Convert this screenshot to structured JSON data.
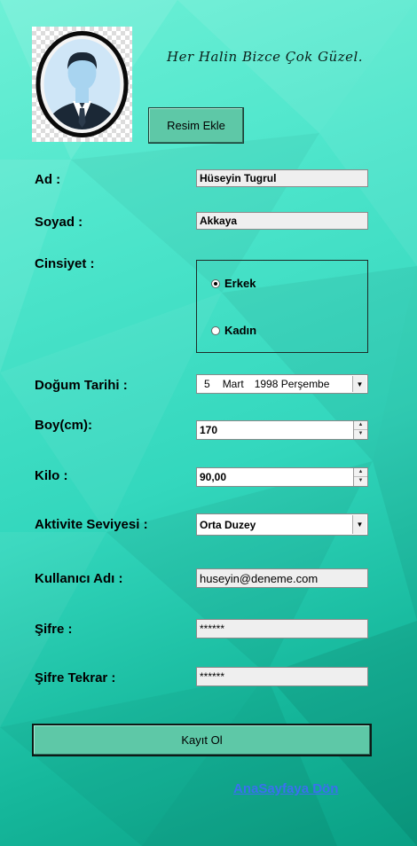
{
  "header": {
    "slogan": "Her Halin Bizce Çok Güzel.",
    "upload_button": "Resim Ekle"
  },
  "form": {
    "first_name_label": "Ad :",
    "first_name_value": "Hüseyin Tugrul",
    "last_name_label": "Soyad :",
    "last_name_value": "Akkaya",
    "gender_label": "Cinsiyet :",
    "gender_options": [
      "Erkek",
      "Kadın"
    ],
    "gender_selected": "Erkek",
    "birthdate_label": "Doğum Tarihi :",
    "birthdate_day": "5",
    "birthdate_month": "Mart",
    "birthdate_year_weekday": "1998 Perşembe",
    "height_label": "Boy(cm):",
    "height_value": "170",
    "weight_label": "Kilo :",
    "weight_value": "90,00",
    "activity_label": "Aktivite Seviyesi :",
    "activity_value": "Orta Duzey",
    "username_label": "Kullanıcı Adı :",
    "username_value": "huseyin@deneme.com",
    "password_label": "Şifre :",
    "password_value": "******",
    "password_repeat_label": "Şifre Tekrar :",
    "password_repeat_value": "******",
    "register_button": "Kayıt Ol",
    "back_link": "AnaSayfaya Dön"
  },
  "colors": {
    "accent_button": "#5ec8a7",
    "link": "#3b6ff0"
  },
  "icons": {
    "avatar": "user-avatar-icon",
    "spinner": "spin-up-down-icon",
    "dropdown": "chevron-down-icon"
  }
}
